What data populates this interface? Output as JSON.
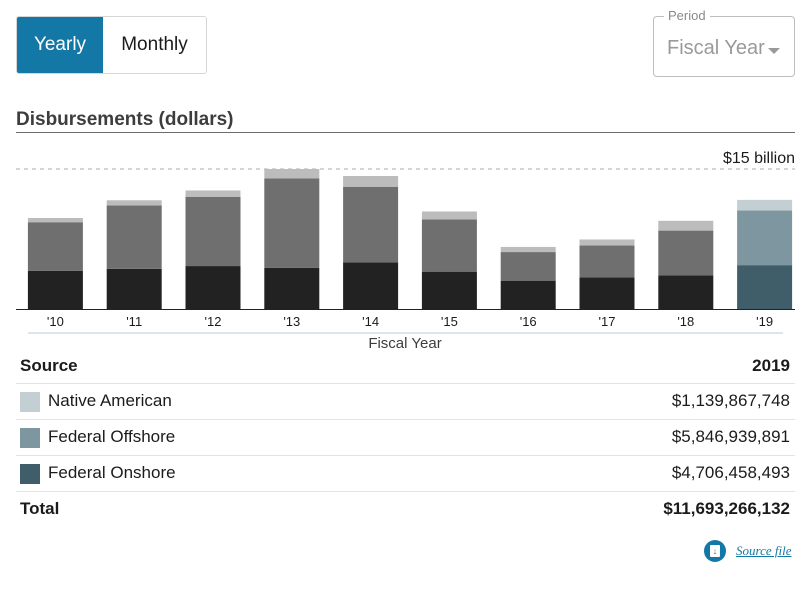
{
  "toggle": {
    "yearly": "Yearly",
    "monthly": "Monthly",
    "selected": "Yearly"
  },
  "period": {
    "label": "Period",
    "value": "Fiscal Year"
  },
  "section": {
    "title": "Disbursements (dollars)"
  },
  "colors": {
    "accent": "#1478a6",
    "bar_top": "#bcbcbc",
    "bar_mid": "#6f6f6f",
    "bar_bottom": "#222222",
    "sel_top": "#c3cfd3",
    "sel_mid": "#7d969f",
    "sel_bottom": "#3f5e6a"
  },
  "chart_data": {
    "type": "bar",
    "stacked": true,
    "categories": [
      "'10",
      "'11",
      "'12",
      "'13",
      "'14",
      "'15",
      "'16",
      "'17",
      "'18",
      "'19"
    ],
    "series": [
      {
        "name": "Federal Onshore",
        "values": [
          4.1,
          4.3,
          4.6,
          4.4,
          5.0,
          4.0,
          3.0,
          3.4,
          3.6,
          4.7
        ]
      },
      {
        "name": "Federal Offshore",
        "values": [
          5.2,
          6.8,
          7.4,
          9.6,
          8.1,
          5.6,
          3.1,
          3.4,
          4.8,
          5.85
        ]
      },
      {
        "name": "Native American",
        "values": [
          0.45,
          0.55,
          0.7,
          1.0,
          1.15,
          0.85,
          0.55,
          0.65,
          1.05,
          1.14
        ]
      }
    ],
    "selected_category": "'19",
    "ylim": [
      0,
      15
    ],
    "max_label": "$15 billion",
    "xlabel": "Fiscal Year",
    "grid": false
  },
  "table": {
    "header": {
      "source": "Source",
      "year": "2019"
    },
    "rows": [
      {
        "label": "Native American",
        "value": "$1,139,867,748",
        "color": "#c3cfd3"
      },
      {
        "label": "Federal Offshore",
        "value": "$5,846,939,891",
        "color": "#7d969f"
      },
      {
        "label": "Federal Onshore",
        "value": "$4,706,458,493",
        "color": "#3f5e6a"
      }
    ],
    "total": {
      "label": "Total",
      "value": "$11,693,266,132"
    }
  },
  "source_file": {
    "label": "Source file",
    "icon": "download-icon"
  }
}
